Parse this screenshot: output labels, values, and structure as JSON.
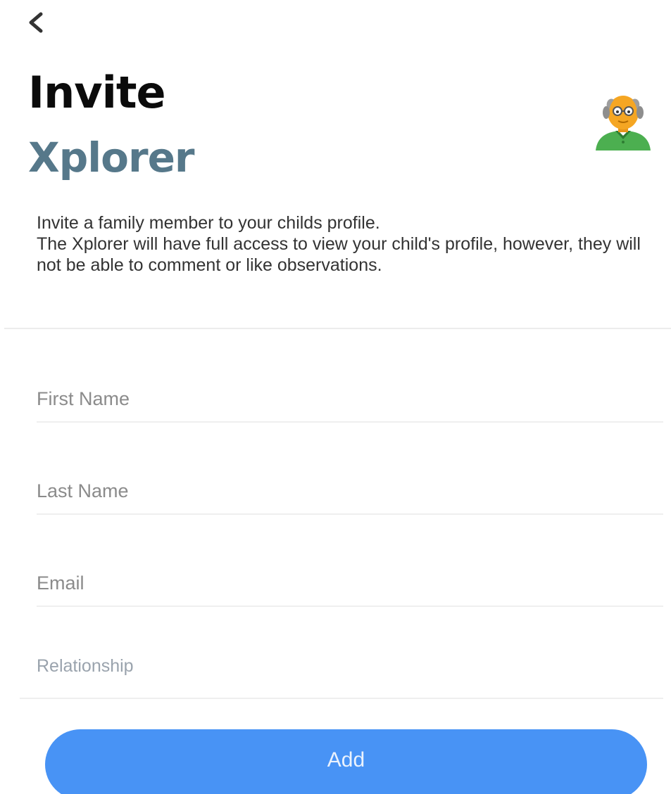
{
  "header": {
    "back_icon": "chevron-left-icon",
    "title": "Invite",
    "subtitle": "Xplorer",
    "avatar_icon": "grandfather-avatar-icon"
  },
  "description": {
    "line1": "Invite a family member to your childs profile.",
    "line2": "The Xplorer will have full access to view your child's profile, however, they will not be able to comment or like observations."
  },
  "form": {
    "first_name": {
      "placeholder": "First Name",
      "value": ""
    },
    "last_name": {
      "placeholder": "Last Name",
      "value": ""
    },
    "email": {
      "placeholder": "Email",
      "value": ""
    },
    "relationship": {
      "placeholder": "Relationship",
      "value": ""
    }
  },
  "actions": {
    "add_label": "Add"
  },
  "colors": {
    "title": "#0b0b0b",
    "subtitle": "#56788a",
    "accent": "#4893f5",
    "avatar_shirt": "#4caf50",
    "avatar_skin": "#f5a623"
  }
}
